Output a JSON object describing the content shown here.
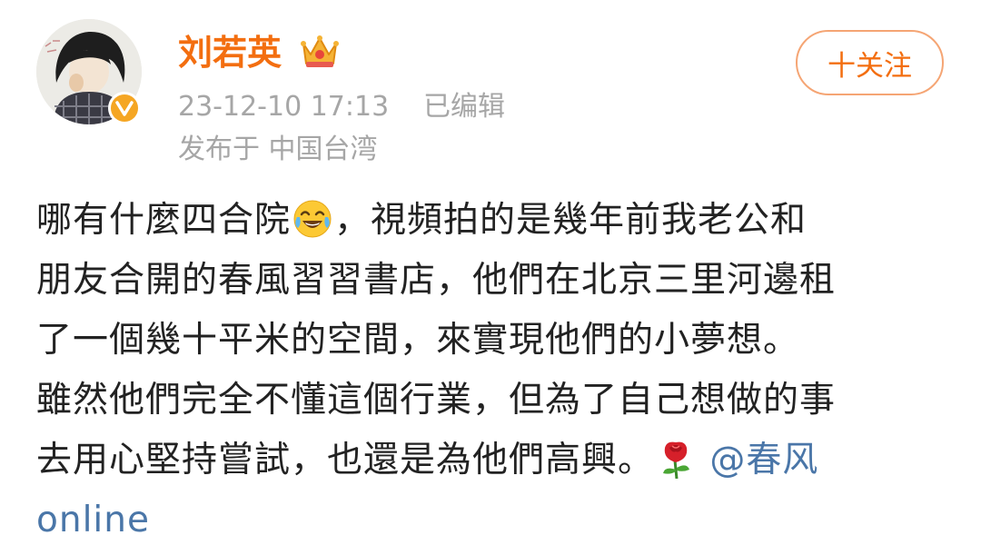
{
  "user": {
    "name": "刘若英",
    "badge_icon": "crown-icon",
    "verified_icon": "verified-v-icon"
  },
  "meta": {
    "time": "23-12-10 17:13",
    "edited": "已编辑",
    "location": "发布于 中国台湾"
  },
  "follow_button": {
    "label": "十关注"
  },
  "post": {
    "line1_a": "哪有什麼四合院",
    "line1_emoji": "laughing-crying-emoji",
    "line1_b": "，視頻拍的是幾年前我老公和",
    "line2": "朋友合開的春風習習書店，他們在北京三里河邊租",
    "line3": "了一個幾十平米的空間，來實現他們的小夢想。",
    "line4": "雖然他們完全不懂這個行業，但為了自己想做的事",
    "line5_a": "去用心堅持嘗試，也還是為他們高興。",
    "line5_emoji": "rose-emoji",
    "mention_a": "@春风",
    "mention_b": "online"
  },
  "colors": {
    "username": "#f36e10",
    "meta": "#a6a6a6",
    "mention": "#4a76a8",
    "text": "#222222"
  }
}
